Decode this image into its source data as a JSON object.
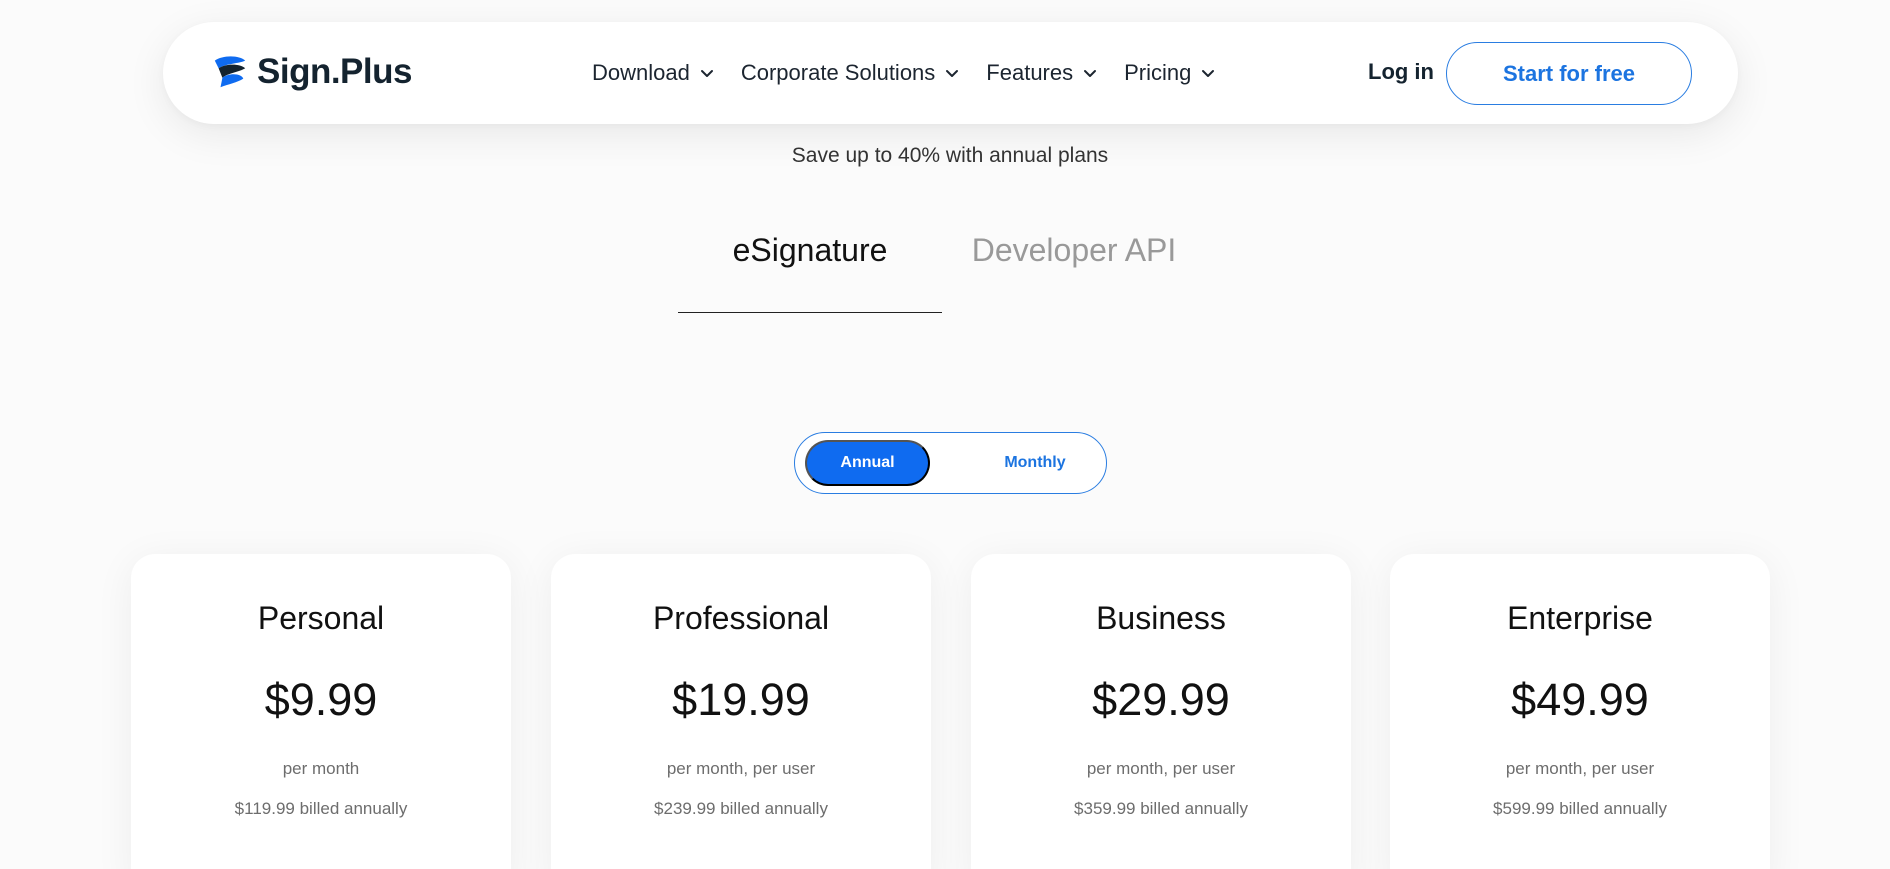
{
  "header": {
    "brand": "Sign.Plus",
    "nav": [
      {
        "label": "Download"
      },
      {
        "label": "Corporate Solutions"
      },
      {
        "label": "Features"
      },
      {
        "label": "Pricing"
      }
    ],
    "login_label": "Log in",
    "cta_label": "Start for free"
  },
  "hero": {
    "save_note": "Save up to 40% with annual plans",
    "tabs": [
      {
        "label": "eSignature",
        "active": true
      },
      {
        "label": "Developer API",
        "active": false
      }
    ]
  },
  "billing_toggle": {
    "annual_label": "Annual",
    "monthly_label": "Monthly",
    "selected": "Annual"
  },
  "plans": [
    {
      "name": "Personal",
      "price": "$9.99",
      "period": "per month",
      "billed": "$119.99 billed annually"
    },
    {
      "name": "Professional",
      "price": "$19.99",
      "period": "per month, per user",
      "billed": "$239.99 billed annually"
    },
    {
      "name": "Business",
      "price": "$29.99",
      "period": "per month, per user",
      "billed": "$359.99 billed annually"
    },
    {
      "name": "Enterprise",
      "price": "$49.99",
      "period": "per month, per user",
      "billed": "$599.99 billed annually"
    }
  ],
  "colors": {
    "accent": "#0f6bf0",
    "accent_text": "#1c74e0",
    "brand_dark": "#14232f"
  },
  "icons": {
    "logo": "signplus-logo-icon",
    "dropdown": "chevron-down-icon"
  }
}
